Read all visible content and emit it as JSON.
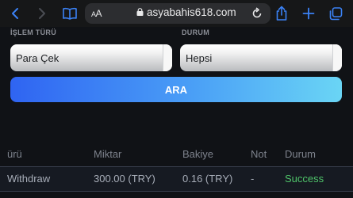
{
  "browser": {
    "aa_label_small": "A",
    "aa_label": "A",
    "url": "asyabahis618.com"
  },
  "form": {
    "transaction_type_label": "İŞLEM TÜRÜ",
    "transaction_type_value": "Para Çek",
    "status_label": "DURUM",
    "status_value": "Hepsi",
    "search_label": "ARA"
  },
  "table": {
    "headers": [
      "ürü",
      "Miktar",
      "Bakiye",
      "Not",
      "Durum"
    ],
    "rows": [
      {
        "type": "Withdraw",
        "amount": "300.00 (TRY)",
        "balance": "0.16 (TRY)",
        "note": "-",
        "status": "Success"
      }
    ]
  },
  "colors": {
    "accent_start": "#2f64f2",
    "accent_end": "#6ad5f5",
    "success": "#4fc46a",
    "browser_icon": "#3b82f6"
  },
  "icons": {
    "back": "chevron-left-icon",
    "forward": "chevron-right-icon",
    "bookmarks": "book-icon",
    "lock": "lock-icon",
    "reload": "reload-icon",
    "share": "share-icon",
    "new_tab": "plus-icon",
    "tabs": "tabs-icon"
  }
}
